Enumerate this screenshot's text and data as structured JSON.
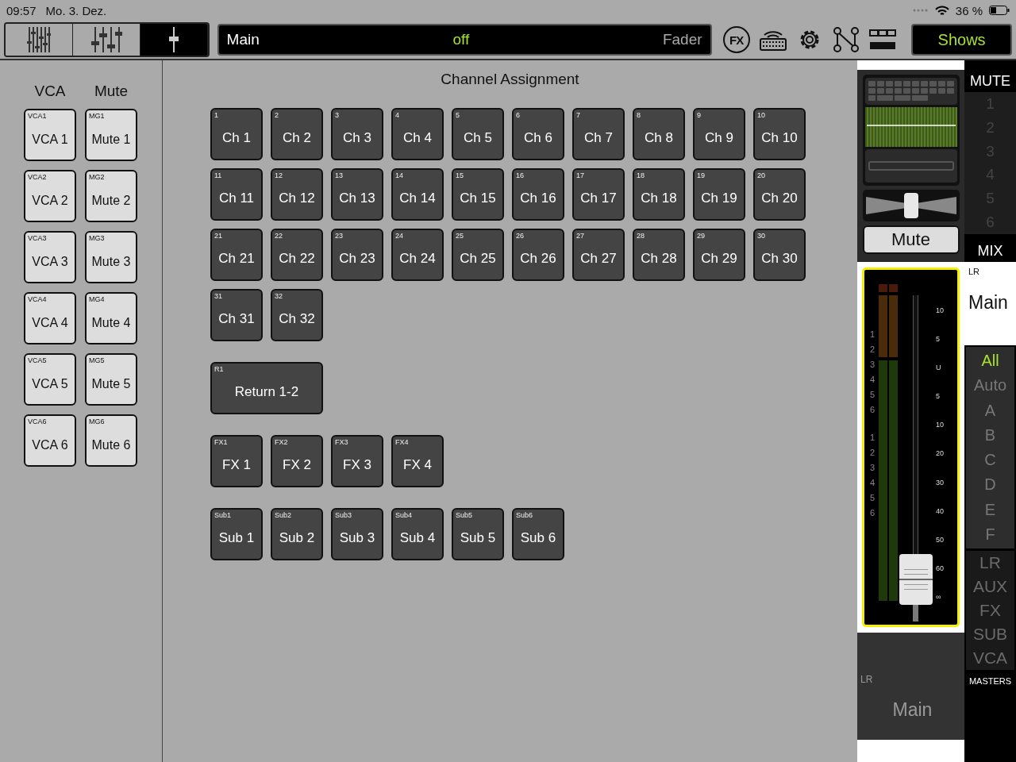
{
  "status_bar": {
    "time": "09:57",
    "date": "Mo. 3. Dez.",
    "battery": "36 %"
  },
  "view_tabs": [
    {
      "kind": "many",
      "selected": false
    },
    {
      "kind": "few",
      "selected": false
    },
    {
      "kind": "single",
      "selected": true
    }
  ],
  "channel_display": {
    "name": "Main",
    "state": "off",
    "mode": "Fader"
  },
  "toolbar_buttons": [
    {
      "kind": "fx",
      "label": "FX"
    },
    {
      "kind": "keyboard"
    },
    {
      "kind": "gear"
    },
    {
      "kind": "routing"
    },
    {
      "kind": "layout"
    }
  ],
  "shows_button": "Shows",
  "groups": {
    "headers": [
      "VCA",
      "Mute"
    ],
    "vca": [
      {
        "tag": "VCA1",
        "label": "VCA 1"
      },
      {
        "tag": "VCA2",
        "label": "VCA 2"
      },
      {
        "tag": "VCA3",
        "label": "VCA 3"
      },
      {
        "tag": "VCA4",
        "label": "VCA 4"
      },
      {
        "tag": "VCA5",
        "label": "VCA 5"
      },
      {
        "tag": "VCA6",
        "label": "VCA 6"
      }
    ],
    "mute": [
      {
        "tag": "MG1",
        "label": "Mute 1"
      },
      {
        "tag": "MG2",
        "label": "Mute 2"
      },
      {
        "tag": "MG3",
        "label": "Mute 3"
      },
      {
        "tag": "MG4",
        "label": "Mute 4"
      },
      {
        "tag": "MG5",
        "label": "Mute 5"
      },
      {
        "tag": "MG6",
        "label": "Mute 6"
      }
    ]
  },
  "assignment": {
    "title": "Channel Assignment",
    "sections": [
      {
        "kind": "normal",
        "items": [
          {
            "tag": "1",
            "label": "Ch 1"
          },
          {
            "tag": "2",
            "label": "Ch 2"
          },
          {
            "tag": "3",
            "label": "Ch 3"
          },
          {
            "tag": "4",
            "label": "Ch 4"
          },
          {
            "tag": "5",
            "label": "Ch 5"
          },
          {
            "tag": "6",
            "label": "Ch 6"
          },
          {
            "tag": "7",
            "label": "Ch 7"
          },
          {
            "tag": "8",
            "label": "Ch 8"
          },
          {
            "tag": "9",
            "label": "Ch 9"
          },
          {
            "tag": "10",
            "label": "Ch 10"
          },
          {
            "tag": "11",
            "label": "Ch 11"
          },
          {
            "tag": "12",
            "label": "Ch 12"
          },
          {
            "tag": "13",
            "label": "Ch 13"
          },
          {
            "tag": "14",
            "label": "Ch 14"
          },
          {
            "tag": "15",
            "label": "Ch 15"
          },
          {
            "tag": "16",
            "label": "Ch 16"
          },
          {
            "tag": "17",
            "label": "Ch 17"
          },
          {
            "tag": "18",
            "label": "Ch 18"
          },
          {
            "tag": "19",
            "label": "Ch 19"
          },
          {
            "tag": "20",
            "label": "Ch 20"
          },
          {
            "tag": "21",
            "label": "Ch 21"
          },
          {
            "tag": "22",
            "label": "Ch 22"
          },
          {
            "tag": "23",
            "label": "Ch 23"
          },
          {
            "tag": "24",
            "label": "Ch 24"
          },
          {
            "tag": "25",
            "label": "Ch 25"
          },
          {
            "tag": "26",
            "label": "Ch 26"
          },
          {
            "tag": "27",
            "label": "Ch 27"
          },
          {
            "tag": "28",
            "label": "Ch 28"
          },
          {
            "tag": "29",
            "label": "Ch 29"
          },
          {
            "tag": "30",
            "label": "Ch 30"
          },
          {
            "tag": "31",
            "label": "Ch 31"
          },
          {
            "tag": "32",
            "label": "Ch 32"
          }
        ]
      },
      {
        "kind": "wide",
        "items": [
          {
            "tag": "R1",
            "label": "Return 1-2"
          }
        ]
      },
      {
        "kind": "normal",
        "items": [
          {
            "tag": "FX1",
            "label": "FX 1"
          },
          {
            "tag": "FX2",
            "label": "FX 2"
          },
          {
            "tag": "FX3",
            "label": "FX 3"
          },
          {
            "tag": "FX4",
            "label": "FX 4"
          }
        ]
      },
      {
        "kind": "normal",
        "items": [
          {
            "tag": "Sub1",
            "label": "Sub 1"
          },
          {
            "tag": "Sub2",
            "label": "Sub 2"
          },
          {
            "tag": "Sub3",
            "label": "Sub 3"
          },
          {
            "tag": "Sub4",
            "label": "Sub 4"
          },
          {
            "tag": "Sub5",
            "label": "Sub 5"
          },
          {
            "tag": "Sub6",
            "label": "Sub 6"
          }
        ]
      }
    ]
  },
  "strip": {
    "pan": {
      "level": 0.5
    },
    "mute_button": "Mute",
    "meter": {
      "labels_a": [
        "1",
        "2",
        "3",
        "4",
        "5",
        "6"
      ],
      "labels_b": [
        "1",
        "2",
        "3",
        "4",
        "5",
        "6"
      ],
      "scale": [
        "10",
        "5",
        "U",
        "5",
        "10",
        "20",
        "30",
        "40",
        "50",
        "60",
        "∞"
      ],
      "fader": {
        "level": 0.05
      }
    },
    "footer": {
      "tag": "LR",
      "name": "Main"
    }
  },
  "side": {
    "mute_title": "MUTE",
    "mute_numbers": [
      "1",
      "2",
      "3",
      "4",
      "5",
      "6"
    ],
    "mix_title": "MIX",
    "bus_tag": "LR",
    "bus_name": "Main",
    "filters": [
      {
        "label": "All",
        "selected": true
      },
      {
        "label": "Auto",
        "selected": false
      },
      {
        "label": "A",
        "selected": false
      },
      {
        "label": "B",
        "selected": false
      },
      {
        "label": "C",
        "selected": false
      },
      {
        "label": "D",
        "selected": false
      },
      {
        "label": "E",
        "selected": false
      },
      {
        "label": "F",
        "selected": false
      }
    ],
    "masters": [
      "LR",
      "AUX",
      "FX",
      "SUB",
      "VCA"
    ],
    "masters_title": "MASTERS"
  }
}
